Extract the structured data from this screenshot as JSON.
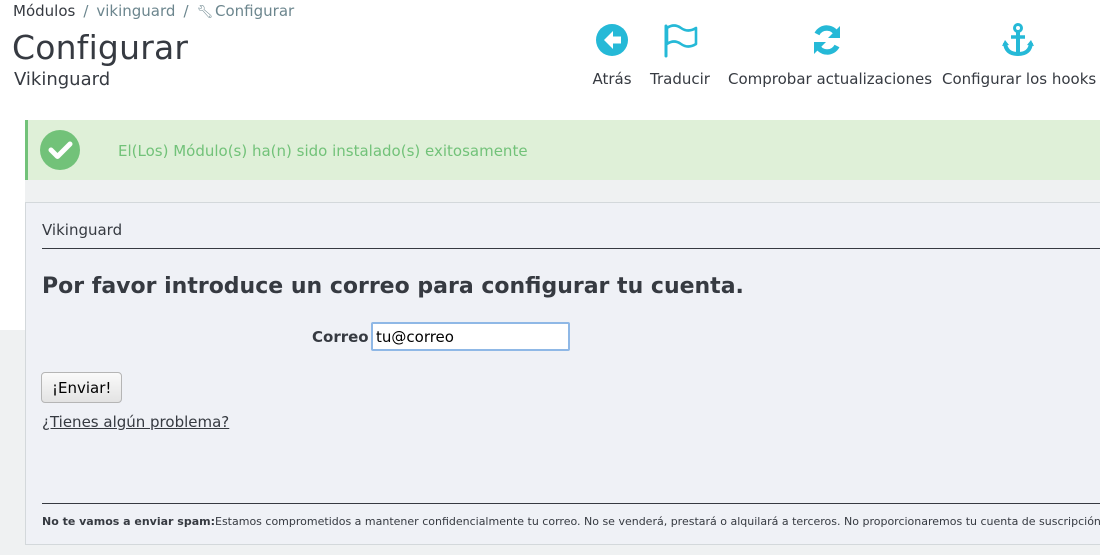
{
  "breadcrumb": {
    "items": [
      "Módulos",
      "vikinguard",
      "Configurar"
    ]
  },
  "header": {
    "title": "Configurar",
    "subtitle": "Vikinguard"
  },
  "toolbar": {
    "buttons": [
      {
        "label": "Atrás",
        "icon": "arrow-left-circle-icon"
      },
      {
        "label": "Traducir",
        "icon": "flag-icon"
      },
      {
        "label": "Comprobar actualizaciones",
        "icon": "refresh-icon"
      },
      {
        "label": "Configurar los hooks",
        "icon": "anchor-icon"
      }
    ]
  },
  "alert": {
    "message": "El(Los) Módulo(s) ha(n) sido instalado(s) exitosamente"
  },
  "panel": {
    "heading": "Vikinguard",
    "question": "Por favor introduce un correo para configurar tu cuenta.",
    "email_label": "Correo",
    "email_value": "tu@correo",
    "submit_label": "¡Enviar!",
    "help_link": "¿Tienes algún problema?",
    "spam_bold": "No te vamos a enviar spam:",
    "spam_text": "Estamos comprometidos a mantener confidencialmente tu correo. No se venderá, prestará o alquilará a terceros. No proporcionaremos tu cuenta de suscripción a ning"
  },
  "colors": {
    "accent": "#25b9d7",
    "success": "#72c279",
    "success_bg": "#dff0d8",
    "text": "#363a41"
  }
}
